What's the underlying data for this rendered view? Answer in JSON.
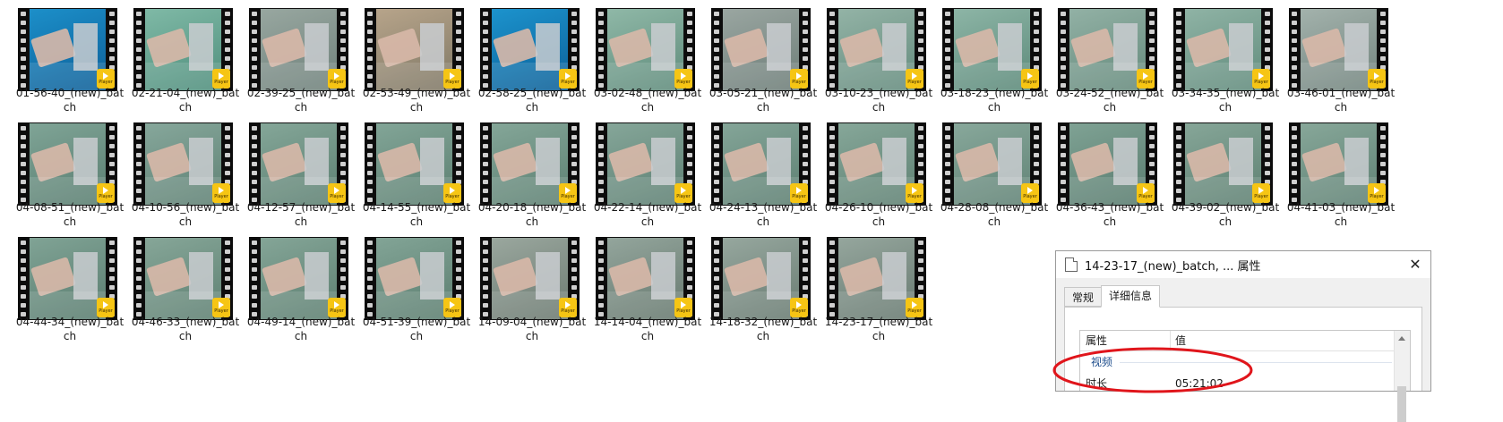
{
  "files": [
    {
      "name": "01-56-40_(new)_batch",
      "tone": [
        "#1c8fc9",
        "#0d5f98"
      ]
    },
    {
      "name": "02-21-04_(new)_batch",
      "tone": [
        "#7fb9a6",
        "#4f8e7c"
      ]
    },
    {
      "name": "02-39-25_(new)_batch",
      "tone": [
        "#98a7a0",
        "#6f817b"
      ]
    },
    {
      "name": "02-53-49_(new)_batch",
      "tone": [
        "#b7a48a",
        "#7f7866"
      ]
    },
    {
      "name": "02-58-25_(new)_batch",
      "tone": [
        "#1c93cd",
        "#0c6098"
      ]
    },
    {
      "name": "03-02-48_(new)_batch",
      "tone": [
        "#8fb8a7",
        "#5f8b7b"
      ]
    },
    {
      "name": "03-05-21_(new)_batch",
      "tone": [
        "#9aa6a1",
        "#6d7d78"
      ]
    },
    {
      "name": "03-10-23_(new)_batch",
      "tone": [
        "#93b3a6",
        "#648b7d"
      ]
    },
    {
      "name": "03-18-23_(new)_batch",
      "tone": [
        "#8db5a6",
        "#5b8979"
      ]
    },
    {
      "name": "03-24-52_(new)_batch",
      "tone": [
        "#92b1a5",
        "#658a7c"
      ]
    },
    {
      "name": "03-34-35_(new)_batch",
      "tone": [
        "#8fb3a5",
        "#618b7c"
      ]
    },
    {
      "name": "03-46-01_(new)_batch",
      "tone": [
        "#a3b2ac",
        "#72847e"
      ]
    },
    {
      "name": "04-08-51_(new)_batch",
      "tone": [
        "#7fa496",
        "#5a7e71"
      ]
    },
    {
      "name": "04-10-56_(new)_batch",
      "tone": [
        "#86a79b",
        "#5f8174"
      ]
    },
    {
      "name": "04-12-57_(new)_batch",
      "tone": [
        "#84a698",
        "#5d8072"
      ]
    },
    {
      "name": "04-14-55_(new)_batch",
      "tone": [
        "#82a597",
        "#5c7f71"
      ]
    },
    {
      "name": "04-20-18_(new)_batch",
      "tone": [
        "#84a698",
        "#5d8072"
      ]
    },
    {
      "name": "04-22-14_(new)_batch",
      "tone": [
        "#85a699",
        "#5e8073"
      ]
    },
    {
      "name": "04-24-13_(new)_batch",
      "tone": [
        "#84a598",
        "#5d7f72"
      ]
    },
    {
      "name": "04-26-10_(new)_batch",
      "tone": [
        "#86a799",
        "#5f8173"
      ]
    },
    {
      "name": "04-28-08_(new)_batch",
      "tone": [
        "#88a89b",
        "#608275"
      ]
    },
    {
      "name": "04-36-43_(new)_batch",
      "tone": [
        "#7fa294",
        "#597c6f"
      ]
    },
    {
      "name": "04-39-02_(new)_batch",
      "tone": [
        "#86a698",
        "#5e8072"
      ]
    },
    {
      "name": "04-41-03_(new)_batch",
      "tone": [
        "#87a799",
        "#5f8174"
      ]
    },
    {
      "name": "04-44-34_(new)_batch",
      "tone": [
        "#80a395",
        "#5a7d70"
      ]
    },
    {
      "name": "04-46-33_(new)_batch",
      "tone": [
        "#86a698",
        "#5e8072"
      ]
    },
    {
      "name": "04-49-14_(new)_batch",
      "tone": [
        "#84a597",
        "#5d7f71"
      ]
    },
    {
      "name": "04-51-39_(new)_batch",
      "tone": [
        "#82a496",
        "#5c7e70"
      ]
    },
    {
      "name": "14-09-04_(new)_batch",
      "tone": [
        "#9aa79e",
        "#6c7a71"
      ]
    },
    {
      "name": "14-14-04_(new)_batch",
      "tone": [
        "#93a59c",
        "#67796f"
      ]
    },
    {
      "name": "14-18-32_(new)_batch",
      "tone": [
        "#96a79e",
        "#697b72"
      ]
    },
    {
      "name": "14-23-17_(new)_batch",
      "tone": [
        "#95a69d",
        "#687a71"
      ]
    }
  ],
  "badge_label": "Player",
  "dialog": {
    "title": "14-23-17_(new)_batch, ... 属性",
    "close": "✕",
    "tabs": [
      "常规",
      "详细信息"
    ],
    "active_tab": 1,
    "columns": {
      "property": "属性",
      "value": "值"
    },
    "group": "视频",
    "rows": [
      {
        "key": "时长",
        "value": "05:21:02"
      }
    ]
  },
  "annotation_color": "#e0151b"
}
